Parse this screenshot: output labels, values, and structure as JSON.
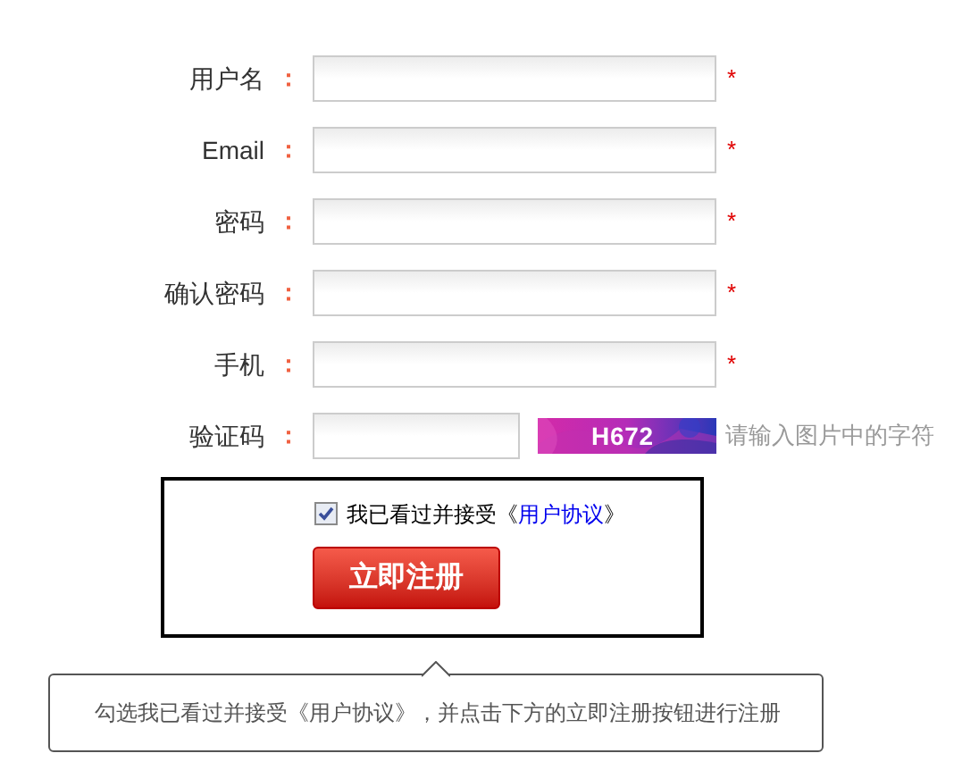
{
  "fields": [
    {
      "kind": "text",
      "label": "用户名",
      "colon": "：",
      "required_mark": "*"
    },
    {
      "kind": "text",
      "label": "Email",
      "colon": "：",
      "required_mark": "*"
    },
    {
      "kind": "password",
      "label": "密码",
      "colon": "：",
      "required_mark": "*"
    },
    {
      "kind": "password",
      "label": "确认密码",
      "colon": "：",
      "required_mark": "*"
    },
    {
      "kind": "text",
      "label": "手机",
      "colon": "：",
      "required_mark": "*"
    },
    {
      "kind": "captcha",
      "label": "验证码",
      "colon": "：",
      "captcha_code": "H672",
      "hint": "请输入图片中的字符"
    }
  ],
  "agreement": {
    "checked": true,
    "text_before": "我已看过并接受《",
    "link": "用户协议",
    "text_after": "》"
  },
  "submit_button": "立即注册",
  "tooltip": "勾选我已看过并接受《用户协议》，并点击下方的立即注册按钮进行注册"
}
